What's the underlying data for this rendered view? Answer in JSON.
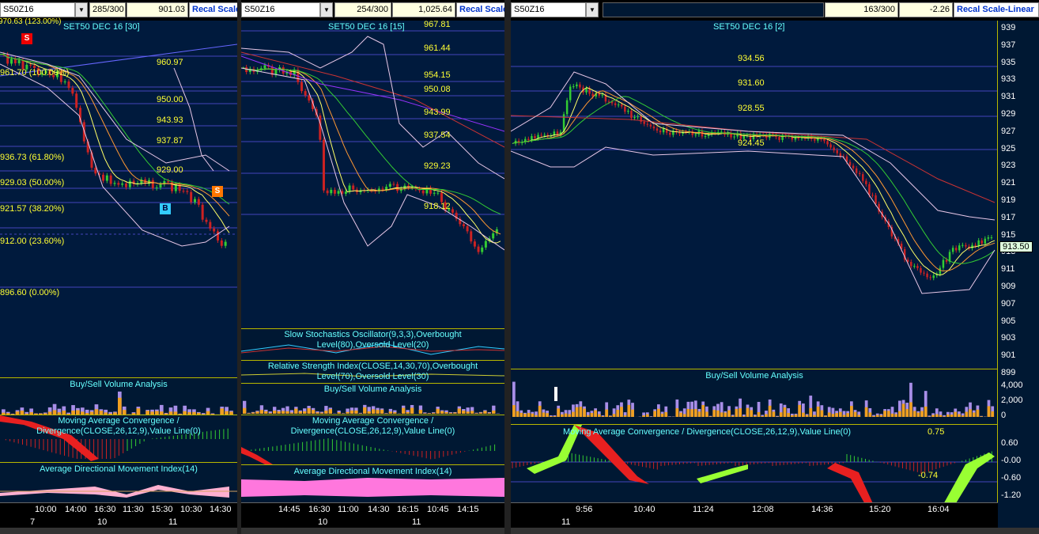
{
  "panels": [
    {
      "symbol": "S50Z16",
      "count": "285/300",
      "last": "901.03",
      "recal": "Recal Scale",
      "title": "SET50 DEC 16  [30]",
      "top_cut": "970.63 (123.00%)",
      "levels": [
        "960.97",
        "950.00",
        "943.93",
        "937.87",
        "929.00"
      ],
      "fib": [
        "961.70 (100.00%)",
        "936.73 (61.80%)",
        "929.03 (50.00%)",
        "921.57 (38.20%)",
        "912.00 (23.60%)",
        "896.60 (0.00%)"
      ],
      "markers": {
        "s1": "S",
        "b": "B",
        "s2": "S"
      },
      "sub": {
        "bsva": "Buy/Sell Volume Analysis",
        "macd": "Moving Average Convergence / Divergence(CLOSE,26,12,9),Value Line(0)",
        "adx": "Average Directional Movement Index(14)"
      },
      "times": [
        "10:00",
        "14:00",
        "16:30",
        "11:30",
        "15:30",
        "10:30",
        "14:30"
      ],
      "dates": [
        "7",
        "10",
        "11"
      ]
    },
    {
      "symbol": "S50Z16",
      "count": "254/300",
      "last": "1,025.64",
      "recal": "Recal Scale",
      "title": "SET50 DEC 16  [15]",
      "levels": [
        "967.81",
        "961.44",
        "954.15",
        "950.08",
        "943.99",
        "937.54",
        "929.23",
        "918.12"
      ],
      "sub": {
        "stoch": "Slow Stochastics Oscillator(9,3,3),Overbought Level(80),Oversold Level(20)",
        "rsi": "Relative Strength Index(CLOSE,14,30,70),Overbought Level(70),Oversold Level(30)",
        "bsva": "Buy/Sell Volume Analysis",
        "macd": "Moving Average Convergence / Divergence(CLOSE,26,12,9),Value Line(0)",
        "adx": "Average Directional Movement Index(14)"
      },
      "times": [
        "14:45",
        "16:30",
        "11:00",
        "14:30",
        "16:15",
        "10:45",
        "14:15"
      ],
      "dates": [
        "10",
        "11"
      ]
    },
    {
      "symbol": "S50Z16",
      "count": "163/300",
      "last": "-2.26",
      "recal": "Recal Scale-Linear",
      "title": "SET50 DEC 16  [2]",
      "levels": [
        "934.56",
        "931.60",
        "928.55",
        "924.45"
      ],
      "price_tag": "913.50",
      "axis": [
        "939",
        "937",
        "935",
        "933",
        "931",
        "929",
        "927",
        "925",
        "923",
        "921",
        "919",
        "917",
        "915",
        "913",
        "911",
        "909",
        "907",
        "905",
        "903",
        "901",
        "899"
      ],
      "vol_axis": [
        "4,000",
        "2,000",
        "0"
      ],
      "macd_axis": [
        "0.60",
        "-0.00",
        "-0.60",
        "-1.20"
      ],
      "macd_vals": {
        "hi": "0.75",
        "lo": "-0.74"
      },
      "sub": {
        "bsva": "Buy/Sell Volume Analysis",
        "macd": "Moving Average Convergence / Divergence(CLOSE,26,12,9),Value Line(0)"
      },
      "times": [
        "9:56",
        "10:40",
        "11:24",
        "12:08",
        "14:36",
        "15:20",
        "16:04"
      ],
      "dates": [
        "11"
      ]
    }
  ],
  "colors": {
    "bg": "#001833",
    "grid": "#3333aa",
    "up": "#33cc33",
    "down": "#cc2222",
    "ma1": "#ffff66",
    "ma2": "#ff9933",
    "ma3": "#33cc33",
    "ma4": "#cc3333",
    "bb": "#e8c8e8",
    "accent": "#b8b800"
  }
}
